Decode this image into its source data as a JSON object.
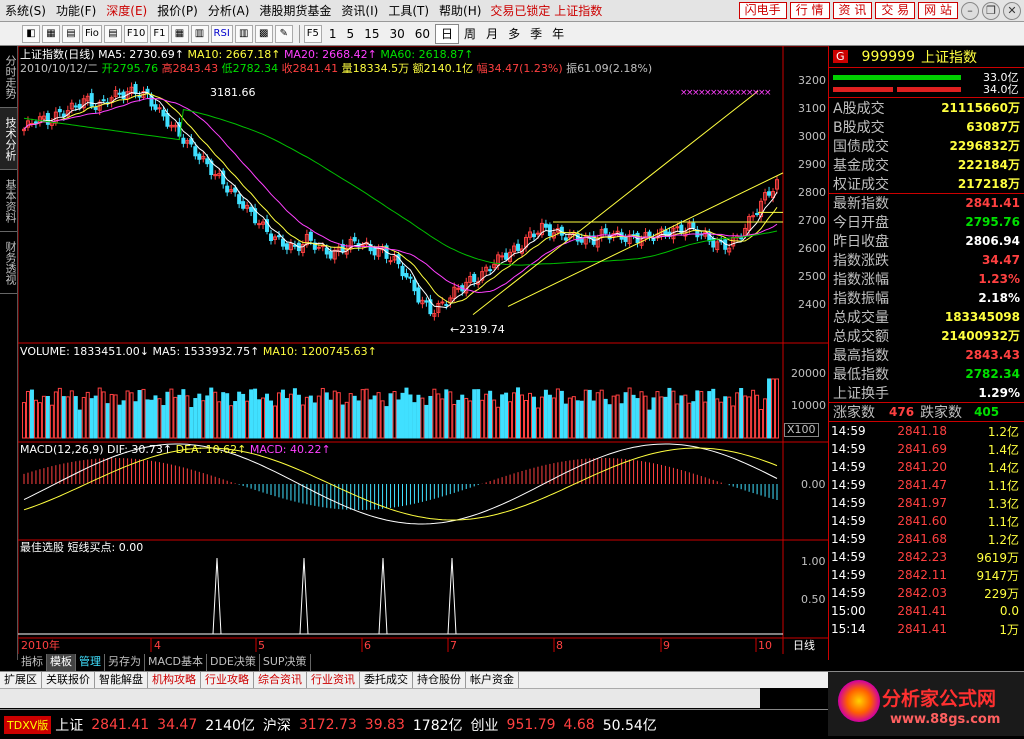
{
  "menubar": {
    "items": [
      "系统(S)",
      "功能(F)",
      "深度(E)",
      "报价(P)",
      "分析(A)",
      "港股期货基金",
      "资讯(I)",
      "工具(T)",
      "帮助(H)"
    ],
    "status": "交易已锁定 上证指数",
    "buttons": [
      "闪电手",
      "行 情",
      "资 讯",
      "交 易",
      "网 站"
    ]
  },
  "toolbar": {
    "icons": [
      "◧",
      "▦",
      "▤",
      "Fio",
      "▤",
      "F10",
      "F1",
      "▦",
      "▥",
      "RSI",
      "▥",
      "▩",
      "✎"
    ],
    "f_btn": "F5",
    "periods": [
      "1",
      "5",
      "15",
      "30",
      "60",
      "日",
      "周",
      "月",
      "多",
      "季",
      "年"
    ],
    "selected_period": "日"
  },
  "left_tabs": [
    "分时走势",
    "技术分析",
    "基本资料",
    "财务透视"
  ],
  "chart": {
    "title_line": "上证指数(日线) MA5: 2730.69↑ MA10: 2667.18↑ MA20: 2668.42↑ MA60: 2618.87↑",
    "title": "上证指数(日线)",
    "ma5": "MA5: 2730.69↑",
    "ma10": "MA10: 2667.18↑",
    "ma20": "MA20: 2668.42↑",
    "ma60": "MA60: 2618.87↑",
    "info_date": "2010/10/12/二",
    "info_open": "开2795.76",
    "info_high": "高2843.43",
    "info_low": "低2782.34",
    "info_close": "收2841.41",
    "info_vol": "量18334.5万",
    "info_amt": "额2140.1亿",
    "info_chg": "幅34.47(1.23%)",
    "info_amp": "振61.09(2.18%)",
    "high_label": "3181.66",
    "low_label": "←2319.74",
    "price_axis": [
      "3200",
      "3100",
      "3000",
      "2900",
      "2800",
      "2700",
      "2600",
      "2500",
      "2400"
    ],
    "vol_header": "VOLUME: 1833451.00↓",
    "vol_ma5": "MA5: 1533932.75↑",
    "vol_ma10": "MA10: 1200745.63↑",
    "vol_axis": [
      "20000",
      "10000"
    ],
    "vol_unit": "X100",
    "macd_header": "MACD(12,26,9)",
    "macd_dif": "DIF: 30.73↑",
    "macd_dea": "DEA: 10.62↑",
    "macd_val": "MACD: 40.22↑",
    "macd_axis": "0.00",
    "best_header": "最佳选股  短线买点: 0.00",
    "best_axis": [
      "1.00",
      "0.50"
    ],
    "x_axis": [
      "2010年",
      "4",
      "5",
      "6",
      "7",
      "8",
      "9",
      "10"
    ],
    "period_label": "日线"
  },
  "chart_data": {
    "type": "candlestick",
    "title": "上证指数(日线)",
    "x_month_labels": [
      "2010年",
      "4",
      "5",
      "6",
      "7",
      "8",
      "9",
      "10"
    ],
    "ylim": [
      2300,
      3250
    ],
    "ohlc_close_path": [
      3040,
      3080,
      3070,
      3100,
      3120,
      3150,
      3120,
      3160,
      3170,
      3180,
      3160,
      3100,
      3050,
      3000,
      2950,
      2900,
      2850,
      2800,
      2750,
      2700,
      2650,
      2620,
      2600,
      2640,
      2600,
      2580,
      2610,
      2630,
      2600,
      2590,
      2560,
      2500,
      2420,
      2370,
      2400,
      2450,
      2480,
      2500,
      2550,
      2580,
      2600,
      2650,
      2680,
      2660,
      2650,
      2640,
      2630,
      2660,
      2650,
      2640,
      2640,
      2650,
      2660,
      2670,
      2680,
      2650,
      2620,
      2610,
      2650,
      2720,
      2790,
      2841.41
    ],
    "special_points": {
      "high": 3181.66,
      "low": 2319.74,
      "last": 2841.41
    },
    "volume_ma5": 1533932.75,
    "volume_ma10": 1200745.63,
    "macd": {
      "dif": 30.73,
      "dea": 10.62,
      "macd": 40.22
    },
    "best_signal_spikes": 4
  },
  "quote_panel": {
    "code": "999999",
    "name": "上证指数",
    "bar1": "33.0亿",
    "bar2": "34.0亿",
    "rows": [
      {
        "label": "A股成交",
        "value": "21115660万",
        "color": "yellow"
      },
      {
        "label": "B股成交",
        "value": "63087万",
        "color": "yellow"
      },
      {
        "label": "国债成交",
        "value": "2296832万",
        "color": "yellow"
      },
      {
        "label": "基金成交",
        "value": "222184万",
        "color": "yellow"
      },
      {
        "label": "权证成交",
        "value": "217218万",
        "color": "yellow"
      },
      {
        "label": "最新指数",
        "value": "2841.41",
        "color": "red"
      },
      {
        "label": "今日开盘",
        "value": "2795.76",
        "color": "green"
      },
      {
        "label": "昨日收盘",
        "value": "2806.94",
        "color": "white"
      },
      {
        "label": "指数涨跌",
        "value": "34.47",
        "color": "red"
      },
      {
        "label": "指数涨幅",
        "value": "1.23%",
        "color": "red"
      },
      {
        "label": "指数振幅",
        "value": "2.18%",
        "color": "white"
      },
      {
        "label": "总成交量",
        "value": "183345098",
        "color": "yellow"
      },
      {
        "label": "总成交额",
        "value": "21400932万",
        "color": "yellow"
      },
      {
        "label": "最高指数",
        "value": "2843.43",
        "color": "red"
      },
      {
        "label": "最低指数",
        "value": "2782.34",
        "color": "green"
      },
      {
        "label": "上证换手",
        "value": "1.29%",
        "color": "white"
      }
    ],
    "rise_label": "涨家数",
    "rise": "476",
    "fall_label": "跌家数",
    "fall": "405",
    "ticks": [
      {
        "t": "14:59",
        "p": "2841.18",
        "v": "1.2亿"
      },
      {
        "t": "14:59",
        "p": "2841.69",
        "v": "1.4亿"
      },
      {
        "t": "14:59",
        "p": "2841.20",
        "v": "1.4亿"
      },
      {
        "t": "14:59",
        "p": "2841.47",
        "v": "1.1亿"
      },
      {
        "t": "14:59",
        "p": "2841.97",
        "v": "1.3亿"
      },
      {
        "t": "14:59",
        "p": "2841.60",
        "v": "1.1亿"
      },
      {
        "t": "14:59",
        "p": "2841.68",
        "v": "1.2亿"
      },
      {
        "t": "14:59",
        "p": "2842.23",
        "v": "9619万"
      },
      {
        "t": "14:59",
        "p": "2842.11",
        "v": "9147万"
      },
      {
        "t": "14:59",
        "p": "2842.03",
        "v": "229万"
      },
      {
        "t": "15:00",
        "p": "2841.41",
        "v": "0.0"
      },
      {
        "t": "15:14",
        "p": "2841.41",
        "v": "1万"
      }
    ]
  },
  "tabs1": [
    "指标",
    "模板",
    "管理",
    "另存为",
    "MACD基本",
    "DDE决策",
    "SUP决策"
  ],
  "tabs2": [
    "扩展区",
    "关联报价",
    "智能解盘",
    "机构攻略",
    "行业攻略",
    "综合资讯",
    "行业资讯",
    "委托成交",
    "持仓股份",
    "帐户资金"
  ],
  "ticker": {
    "brand": "TDXV版",
    "items": [
      {
        "name": "上证",
        "val": "2841.41",
        "chg": "34.47",
        "amt": "2140亿"
      },
      {
        "name": "沪深",
        "val": "3172.73",
        "chg": "39.83",
        "amt": "1782亿"
      },
      {
        "name": "创业",
        "val": "951.79",
        "chg": "4.68",
        "amt": "50.54亿"
      }
    ]
  },
  "watermark": {
    "text": "分析家公式网",
    "url": "www.88gs.com",
    "ime": "英"
  }
}
